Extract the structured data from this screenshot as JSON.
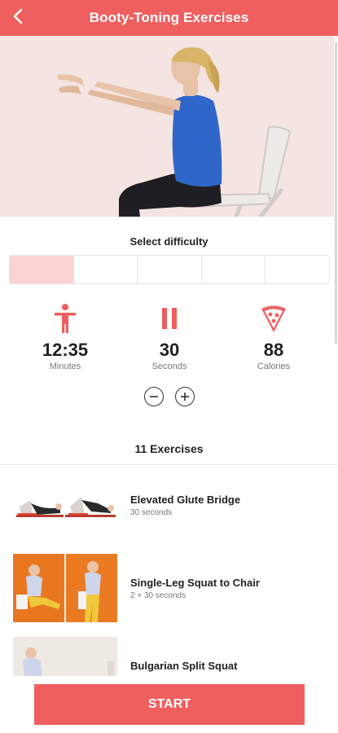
{
  "header": {
    "title": "Booty-Toning Exercises",
    "back_icon": "chevron-left-icon"
  },
  "colors": {
    "accent": "#ef5f5f",
    "difficulty_active": "#fbd3d3",
    "hero_bg": "#f4e4e2"
  },
  "difficulty": {
    "label": "Select difficulty",
    "levels_total": 5,
    "selected_level": 1
  },
  "stats": {
    "time": {
      "value": "12:35",
      "unit": "Minutes",
      "icon": "person-icon"
    },
    "rest": {
      "value": "30",
      "unit": "Seconds",
      "icon": "pause-icon"
    },
    "calories": {
      "value": "88",
      "unit": "Calories",
      "icon": "pizza-slice-icon"
    }
  },
  "steppers": {
    "decrease_icon": "minus-circle-icon",
    "increase_icon": "plus-circle-icon"
  },
  "exercises": {
    "count_label": "11 Exercises",
    "items": [
      {
        "name": "Elevated Glute Bridge",
        "duration": "30 seconds"
      },
      {
        "name": "Single-Leg Squat to Chair",
        "duration": "2 × 30 seconds"
      },
      {
        "name": "Bulgarian Split Squat",
        "duration": ""
      }
    ]
  },
  "footer": {
    "start_label": "START"
  }
}
